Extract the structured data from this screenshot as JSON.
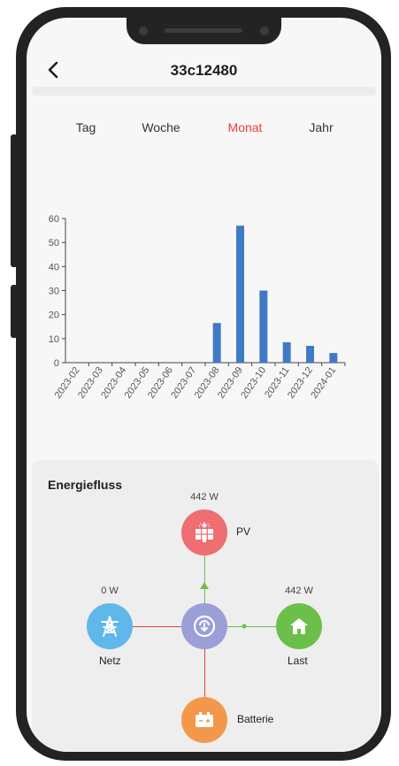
{
  "header": {
    "title": "33c12480"
  },
  "tabs": [
    {
      "label": "Tag",
      "active": false
    },
    {
      "label": "Woche",
      "active": false
    },
    {
      "label": "Monat",
      "active": true
    },
    {
      "label": "Jahr",
      "active": false
    }
  ],
  "chart_data": {
    "type": "bar",
    "categories": [
      "2023-02",
      "2023-03",
      "2023-04",
      "2023-05",
      "2023-06",
      "2023-07",
      "2023-08",
      "2023-09",
      "2023-10",
      "2023-11",
      "2023-12",
      "2024-01"
    ],
    "values": [
      0,
      0,
      0,
      0,
      0,
      0,
      16.5,
      57,
      30,
      8.5,
      7,
      4
    ],
    "ylim": [
      0,
      60
    ],
    "yticks": [
      0,
      10,
      20,
      30,
      40,
      50,
      60
    ],
    "grid": false,
    "bar_color": "#3f7bc4"
  },
  "energy_flow": {
    "title": "Energiefluss",
    "pv": {
      "label": "PV",
      "power": "442 W",
      "color": "#ee6e72",
      "icon": "solar-panel-icon"
    },
    "grid": {
      "label": "Netz",
      "power": "0 W",
      "color": "#5fb7ea",
      "icon": "power-tower-icon"
    },
    "load": {
      "label": "Last",
      "power": "442 W",
      "color": "#6cbf48",
      "icon": "house-icon"
    },
    "battery": {
      "label": "Batterie",
      "color": "#f3984a",
      "icon": "battery-icon"
    },
    "inverter": {
      "color": "#9b9fd8",
      "icon": "inverter-icon"
    },
    "line_color_red": "#d84a40",
    "line_color_green": "#6cbf48"
  }
}
